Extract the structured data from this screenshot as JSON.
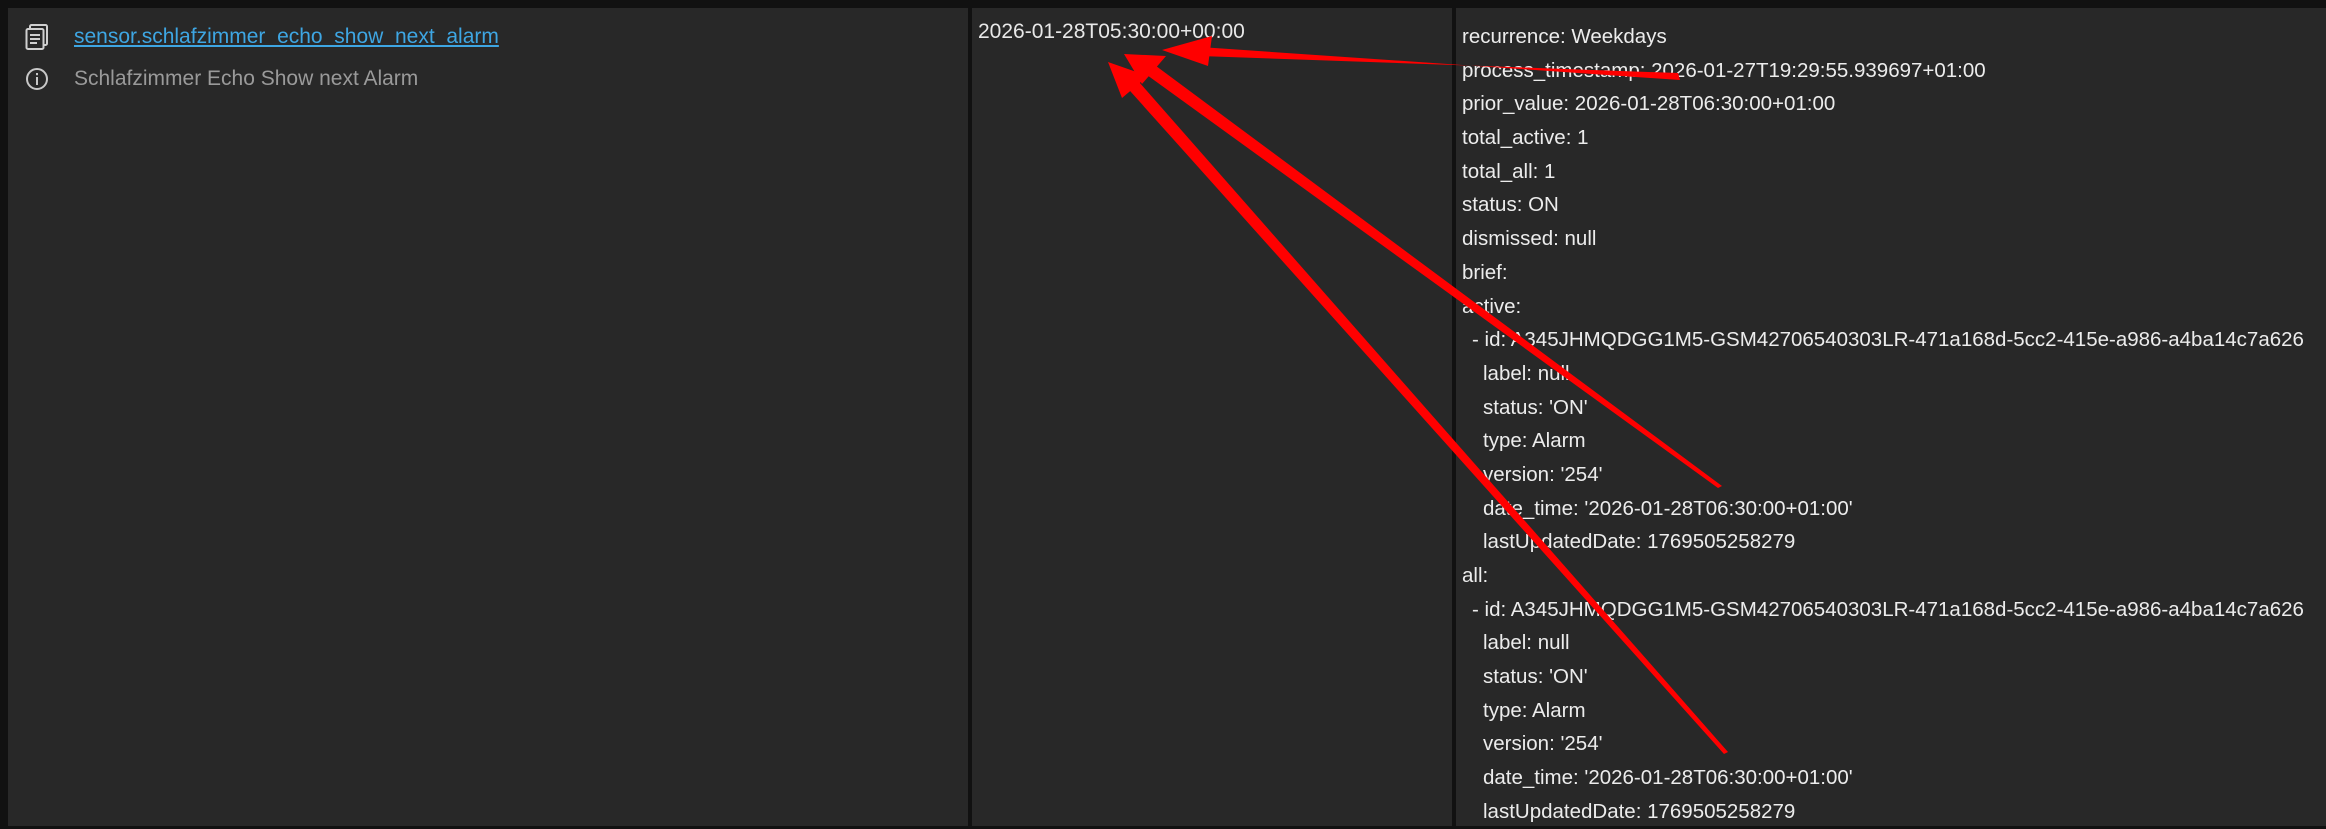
{
  "entity": {
    "entity_id": "sensor.schlafzimmer_echo_show_next_alarm",
    "friendly_name": "Schlafzimmer Echo Show next Alarm",
    "entity_icon": "clipboard-list-icon",
    "info_icon": "info-circle-icon"
  },
  "state": {
    "value": "2026-01-28T05:30:00+00:00"
  },
  "attributes": [
    {
      "text": "recurrence: Weekdays",
      "indent": 0
    },
    {
      "text": "process_timestamp: 2026-01-27T19:29:55.939697+01:00",
      "indent": 0
    },
    {
      "text": "prior_value: 2026-01-28T06:30:00+01:00",
      "indent": 0
    },
    {
      "text": "total_active: 1",
      "indent": 0
    },
    {
      "text": "total_all: 1",
      "indent": 0
    },
    {
      "text": "status: ON",
      "indent": 0
    },
    {
      "text": "dismissed: null",
      "indent": 0
    },
    {
      "text": "brief:",
      "indent": 0
    },
    {
      "text": "active:",
      "indent": 0
    },
    {
      "text": "- id: A345JHMQDGG1M5-GSM42706540303LR-471a168d-5cc2-415e-a986-a4ba14c7a626",
      "indent": 1
    },
    {
      "text": "label: null",
      "indent": 2
    },
    {
      "text": "status: 'ON'",
      "indent": 2
    },
    {
      "text": "type: Alarm",
      "indent": 2
    },
    {
      "text": "version: '254'",
      "indent": 2
    },
    {
      "text": "date_time: '2026-01-28T06:30:00+01:00'",
      "indent": 2
    },
    {
      "text": "lastUpdatedDate: 1769505258279",
      "indent": 2
    },
    {
      "text": "all:",
      "indent": 0
    },
    {
      "text": "- id: A345JHMQDGG1M5-GSM42706540303LR-471a168d-5cc2-415e-a986-a4ba14c7a626",
      "indent": 1
    },
    {
      "text": "label: null",
      "indent": 2
    },
    {
      "text": "status: 'ON'",
      "indent": 2
    },
    {
      "text": "type: Alarm",
      "indent": 2
    },
    {
      "text": "version: '254'",
      "indent": 2
    },
    {
      "text": "date_time: '2026-01-28T06:30:00+01:00'",
      "indent": 2
    },
    {
      "text": "lastUpdatedDate: 1769505258279",
      "indent": 2
    }
  ],
  "colors": {
    "background": "#111111",
    "cell": "#282828",
    "link": "#3ea6e3",
    "annotation_arrow": "#ff0000"
  }
}
